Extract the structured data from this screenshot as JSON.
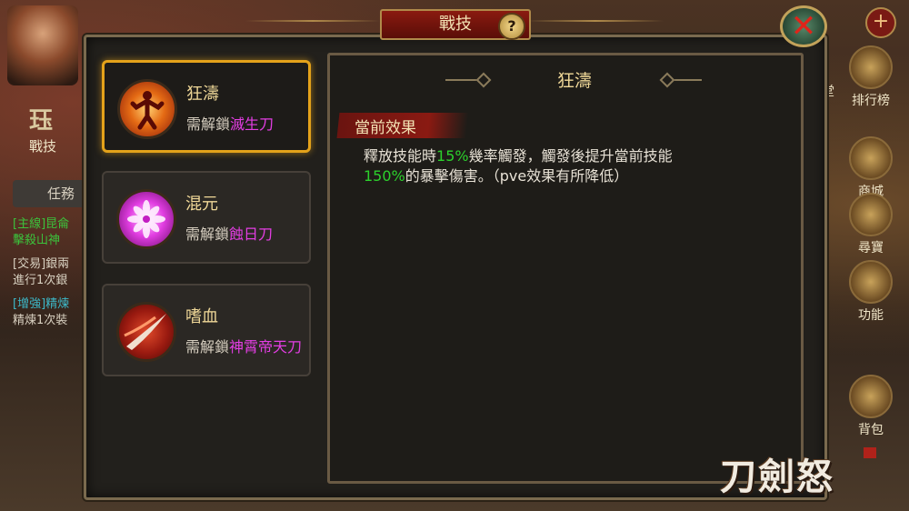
{
  "dialog": {
    "title": "戰技",
    "help_label": "?",
    "close_label": "✕"
  },
  "background_hud": {
    "skill_label": "戰技",
    "skill_icon_glyph": "珏",
    "task_label": "任務",
    "quests": [
      {
        "text": "[主線]昆侖",
        "color": "#3cc23c"
      },
      {
        "text": "擊殺山神",
        "color": "#3cc23c"
      },
      {
        "text": "[交易]銀兩",
        "color": "#d8d0c0"
      },
      {
        "text": "進行1次銀",
        "color": "#d8d0c0"
      },
      {
        "text": "[增強]精煉",
        "color": "#3cb8c8"
      },
      {
        "text": "精煉1次裝",
        "color": "#d8d0c0"
      }
    ],
    "right_buttons": [
      {
        "label": "排行榜"
      },
      {
        "label": "商城"
      },
      {
        "label": "尋寶"
      },
      {
        "label": "功能"
      },
      {
        "label": "背包"
      }
    ],
    "partial_label": "堂",
    "plus_label": "+"
  },
  "skills": [
    {
      "name": "狂濤",
      "req_prefix": "需解鎖",
      "req_blade": "滅生刀",
      "icon": "rage-figure-icon",
      "selected": true
    },
    {
      "name": "混元",
      "req_prefix": "需解鎖",
      "req_blade": "蝕日刀",
      "icon": "lotus-icon",
      "selected": false
    },
    {
      "name": "嗜血",
      "req_prefix": "需解鎖",
      "req_blade": "神霄帝天刀",
      "icon": "blade-slash-icon",
      "selected": false
    }
  ],
  "detail": {
    "title": "狂濤",
    "section_label": "當前效果",
    "effect": {
      "part1": "釋放技能時",
      "rate": "15%",
      "part2": "幾率觸發，觸發後提升當前技能",
      "bonus": "150%",
      "part3": "的暴擊傷害。（pve效果有所降低）"
    }
  },
  "logo": {
    "text": "刀劍怒"
  },
  "colors": {
    "accent_gold": "#e4a21a",
    "highlight_green": "#2cd12c",
    "blade_magenta": "#e43ee4",
    "title_red": "#8a1a10"
  }
}
